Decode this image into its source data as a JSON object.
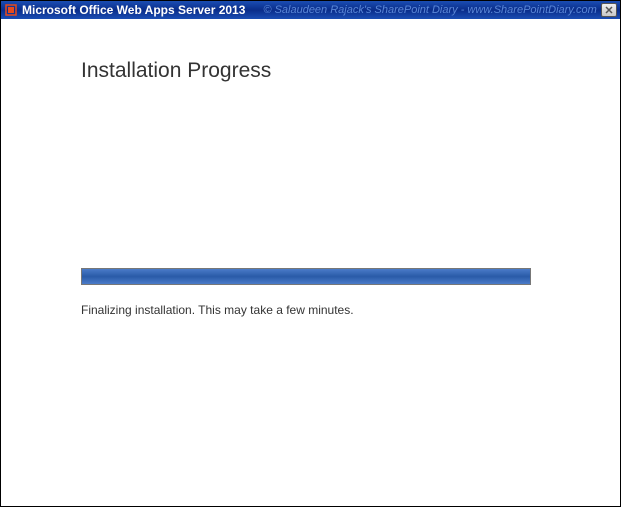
{
  "titlebar": {
    "title": "Microsoft Office Web Apps Server 2013",
    "watermark": "© Salaudeen Rajack's SharePoint Diary - www.SharePointDiary.com"
  },
  "content": {
    "heading": "Installation Progress",
    "status_text": "Finalizing installation. This may take a few minutes.",
    "progress_percent": 100
  }
}
